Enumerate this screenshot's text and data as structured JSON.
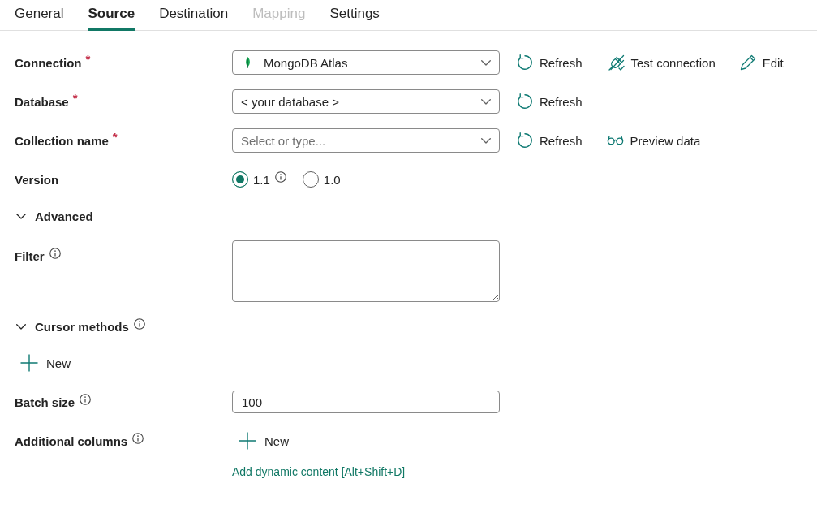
{
  "tabs": [
    {
      "label": "General",
      "selected": false,
      "disabled": false
    },
    {
      "label": "Source",
      "selected": true,
      "disabled": false
    },
    {
      "label": "Destination",
      "selected": false,
      "disabled": false
    },
    {
      "label": "Mapping",
      "selected": false,
      "disabled": true
    },
    {
      "label": "Settings",
      "selected": false,
      "disabled": false
    }
  ],
  "rows": [
    {
      "kind": "connection",
      "label": "Connection",
      "required_mark": "*",
      "value": "MongoDB Atlas",
      "actions": [
        {
          "kind": "refresh",
          "label": "Refresh"
        },
        {
          "kind": "test",
          "label": "Test connection"
        },
        {
          "kind": "edit",
          "label": "Edit"
        }
      ]
    },
    {
      "kind": "select",
      "label": "Database",
      "required_mark": "*",
      "value": "< your database >",
      "actions": [
        {
          "kind": "refresh",
          "label": "Refresh"
        }
      ]
    },
    {
      "kind": "select",
      "label": "Collection name",
      "required_mark": "*",
      "placeholder": "Select or type...",
      "actions": [
        {
          "kind": "refresh",
          "label": "Refresh"
        },
        {
          "kind": "preview",
          "label": "Preview data"
        }
      ]
    },
    {
      "kind": "radio",
      "label": "Version",
      "options": [
        {
          "label": "1.1",
          "selected": true,
          "info": true
        },
        {
          "label": "1.0",
          "selected": false
        }
      ]
    },
    {
      "kind": "section",
      "label": "Advanced",
      "expanded": true
    },
    {
      "kind": "textarea",
      "label": "Filter",
      "info": true
    },
    {
      "kind": "section",
      "label": "Cursor methods",
      "expanded": true,
      "info": true
    },
    {
      "kind": "add",
      "label": "New"
    },
    {
      "kind": "text",
      "label": "Batch size",
      "info": true,
      "value": "100"
    },
    {
      "kind": "add_field",
      "label": "Additional columns",
      "info": true,
      "button": "New",
      "link": "Add dynamic content [Alt+Shift+D]"
    }
  ]
}
